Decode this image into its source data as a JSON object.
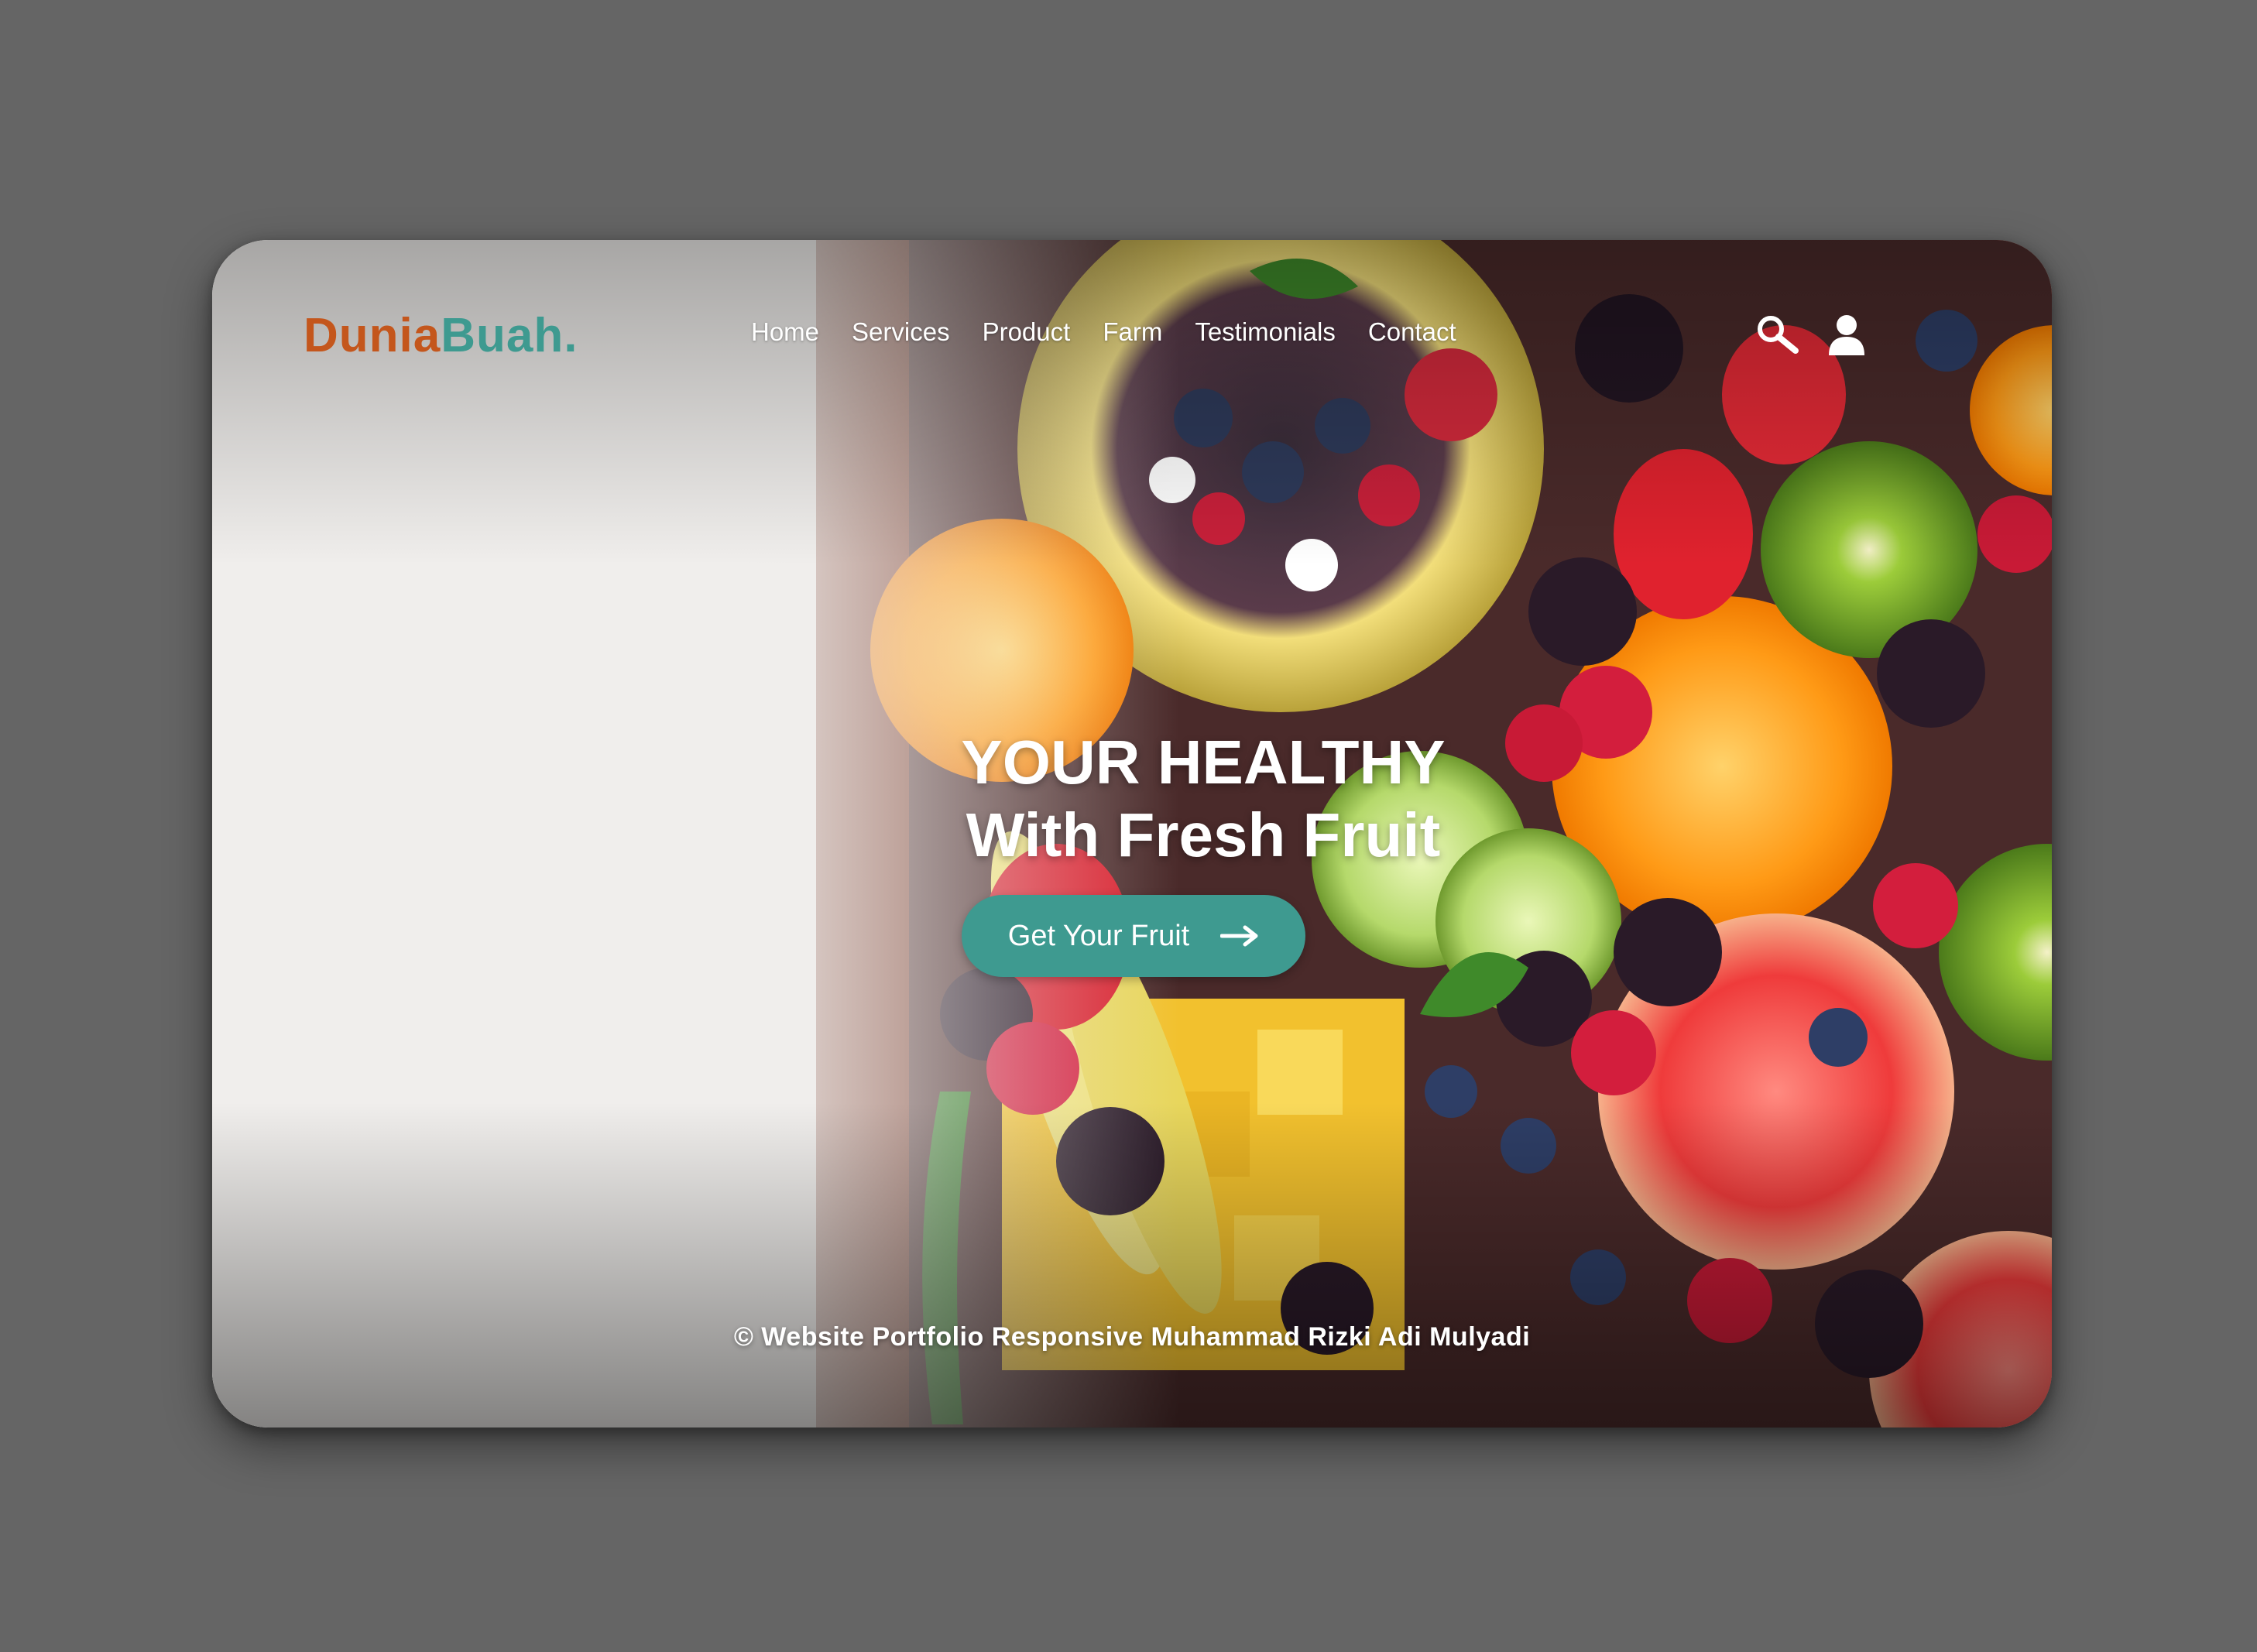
{
  "brand": {
    "name_part1": "Dunia",
    "name_part2": "Buah.",
    "color_part1": "#c4561c",
    "color_part2": "#3e9a90"
  },
  "nav": {
    "items": [
      {
        "label": "Home"
      },
      {
        "label": "Services"
      },
      {
        "label": "Product"
      },
      {
        "label": "Farm"
      },
      {
        "label": "Testimonials"
      },
      {
        "label": "Contact"
      }
    ]
  },
  "header_icons": [
    "search-icon",
    "user-icon"
  ],
  "hero": {
    "title_line1": "YOUR HEALTHY",
    "title_line2": "With Fresh Fruit",
    "background": "fresh fruit platter photo",
    "cta": {
      "label": "Get Your Fruit",
      "icon": "arrow-right-icon",
      "color": "#3e9a90"
    }
  },
  "footer": {
    "text": "© Website Portfolio Responsive Muhammad Rizki Adi Mulyadi"
  }
}
